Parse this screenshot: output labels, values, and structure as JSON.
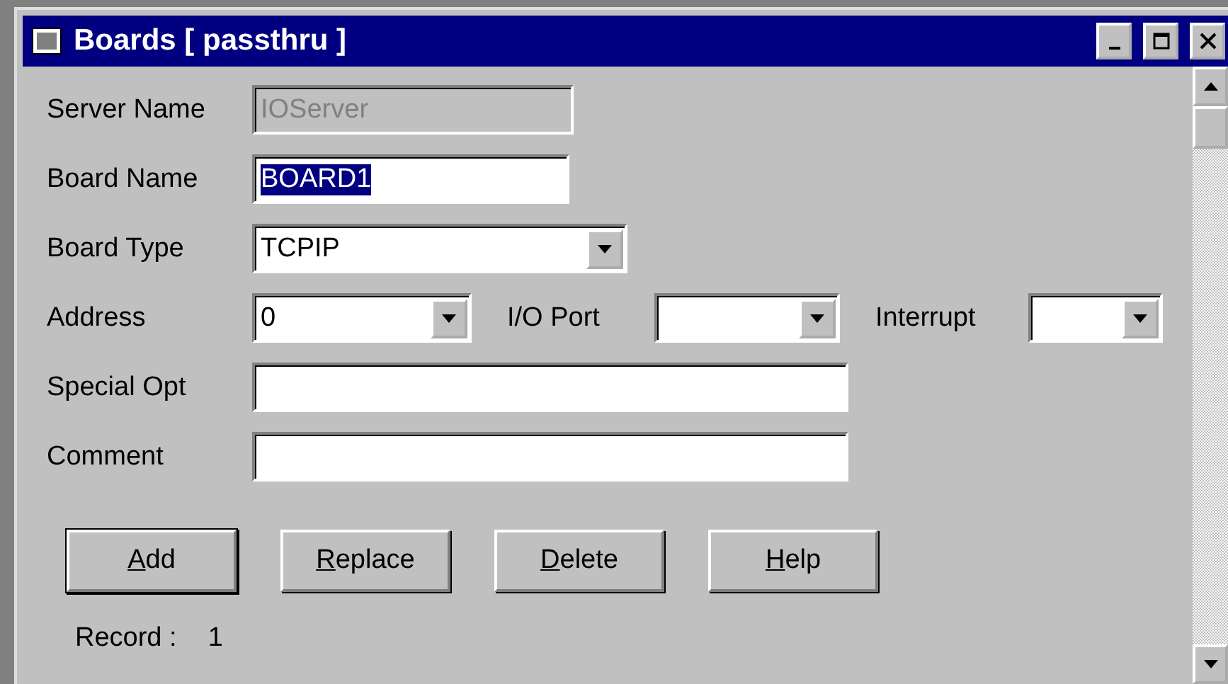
{
  "window": {
    "title": "Boards [ passthru ]"
  },
  "fields": [
    {
      "kind": "text",
      "label": "Server Name",
      "value": "IOServer",
      "disabled": true,
      "selected": false
    },
    {
      "kind": "text",
      "label": "Board Name",
      "value": "BOARD1",
      "disabled": false,
      "selected": true
    },
    {
      "kind": "combo",
      "label": "Board Type",
      "value": "TCPIP"
    }
  ],
  "address_row": [
    {
      "label": "Address",
      "value": "0"
    },
    {
      "label": "I/O Port"
    },
    {
      "label": "Interrupt"
    }
  ],
  "wide_fields": [
    {
      "label": "Special Opt"
    },
    {
      "label": "Comment"
    }
  ],
  "buttons": [
    {
      "key": "A",
      "rest": "dd",
      "default": true
    },
    {
      "key": "R",
      "rest": "eplace",
      "default": false
    },
    {
      "key": "D",
      "rest": "elete",
      "default": false
    },
    {
      "key": "H",
      "rest": "elp",
      "default": false
    }
  ],
  "record": {
    "label": "Record :",
    "value": "1"
  }
}
